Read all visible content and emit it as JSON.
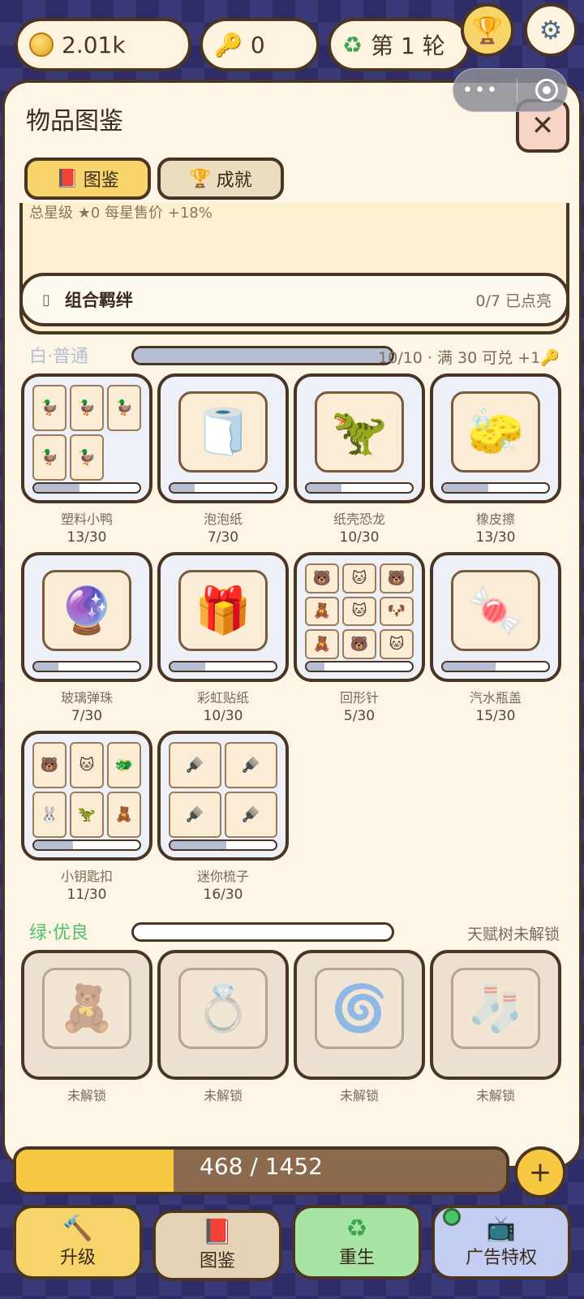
{
  "topbar": {
    "coins": "2.01k",
    "keys": "0",
    "round": "第 1 轮"
  },
  "capsule": {
    "more": "•••"
  },
  "panel": {
    "title": "物品图鉴",
    "close": "✕",
    "tabs": [
      {
        "label": "图鉴",
        "active": true
      },
      {
        "label": "成就",
        "active": false
      }
    ],
    "summary": "总星级 ★0  每星售价 +18%",
    "bond": {
      "title": "组合羁绊",
      "count": "0/7 已点亮"
    }
  },
  "tiers": [
    {
      "name": "白·普通",
      "color": "#b6bed4",
      "progress": 1.0,
      "note": "10/10 · 满 30 可兑 +1",
      "items": [
        {
          "name": "塑料小鸭",
          "count": "13/30",
          "fill": 0.43
        },
        {
          "name": "泡泡纸",
          "count": "7/30",
          "fill": 0.23
        },
        {
          "name": "纸壳恐龙",
          "count": "10/30",
          "fill": 0.33
        },
        {
          "name": "橡皮擦",
          "count": "13/30",
          "fill": 0.43
        },
        {
          "name": "玻璃弹珠",
          "count": "7/30",
          "fill": 0.23
        },
        {
          "name": "彩虹贴纸",
          "count": "10/30",
          "fill": 0.33
        },
        {
          "name": "回形针",
          "count": "5/30",
          "fill": 0.17
        },
        {
          "name": "汽水瓶盖",
          "count": "15/30",
          "fill": 0.5
        },
        {
          "name": "小钥匙扣",
          "count": "11/30",
          "fill": 0.37
        },
        {
          "name": "迷你梳子",
          "count": "16/30",
          "fill": 0.53
        }
      ]
    },
    {
      "name": "绿·优良",
      "color": "#4cc36b",
      "progress": 0,
      "note": "天赋树未解锁",
      "items": [
        {
          "name": "未解锁"
        },
        {
          "name": "未解锁"
        },
        {
          "name": "未解锁"
        },
        {
          "name": "未解锁"
        }
      ]
    }
  ],
  "bottom": {
    "progress_text": "468 / 1452",
    "progress": 0.322,
    "plus": "+",
    "nav": [
      {
        "label": "升级",
        "color": "#f7d56b"
      },
      {
        "label": "图鉴",
        "color": "#e6d3b6"
      },
      {
        "label": "重生",
        "color": "#a8e4a4"
      },
      {
        "label": "广告特权",
        "color": "#c3cdf2"
      }
    ]
  }
}
